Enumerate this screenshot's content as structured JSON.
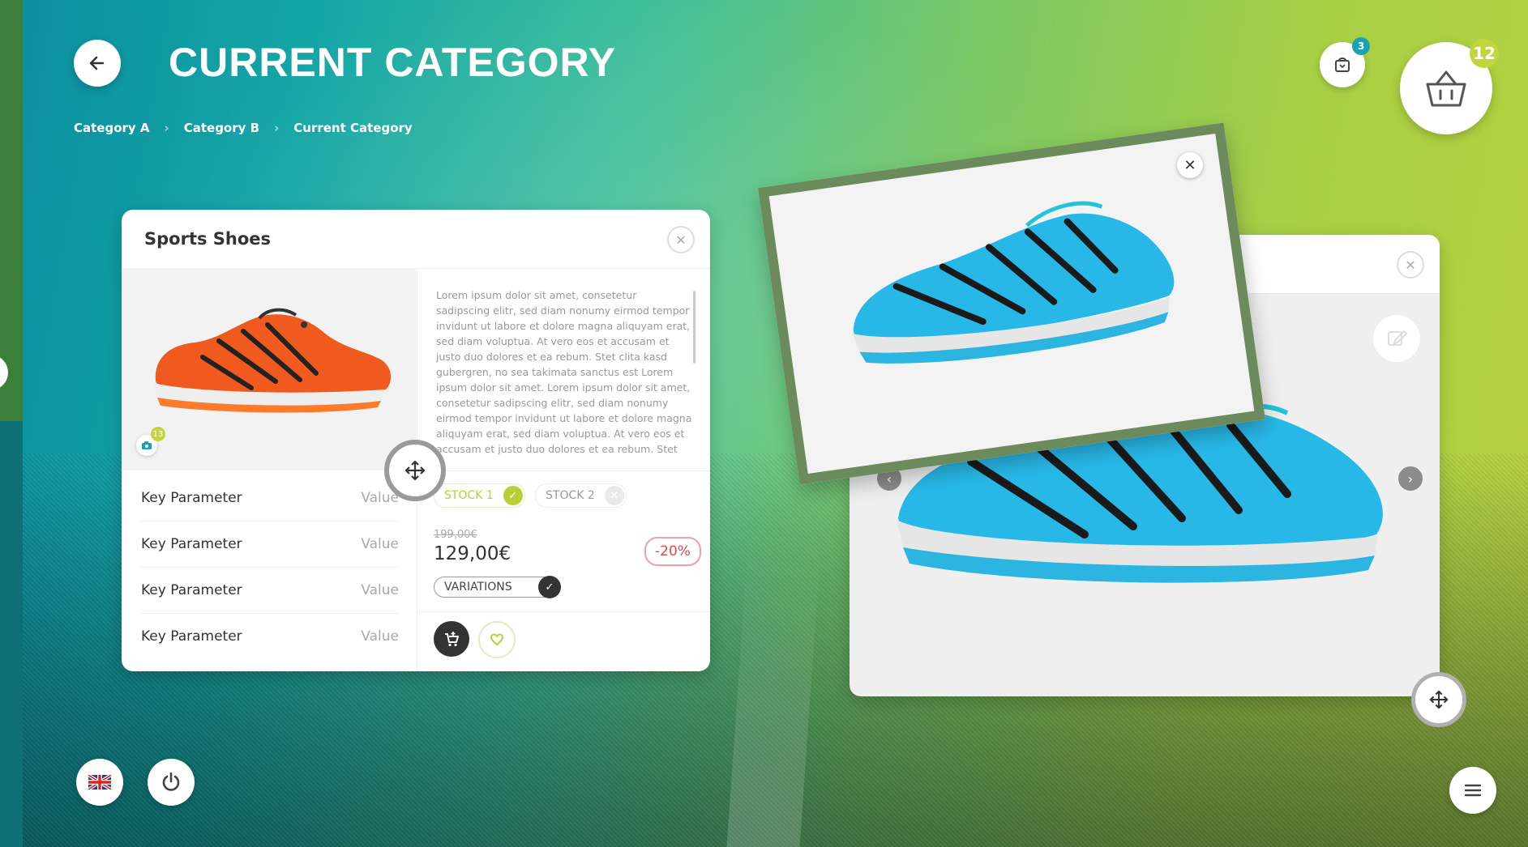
{
  "header": {
    "title": "CURRENT CATEGORY",
    "breadcrumb": [
      "Category A",
      "Category B",
      "Current Category"
    ],
    "small_cart_count": "3",
    "basket_count": "12"
  },
  "product_card": {
    "title": "Sports Shoes",
    "image_count": "13",
    "description": "Lorem ipsum dolor sit amet, consetetur sadipscing elitr, sed diam nonumy eirmod tempor invidunt ut labore et dolore magna aliquyam erat, sed diam voluptua. At vero eos et accusam et justo duo dolores et ea rebum. Stet clita kasd gubergren, no sea takimata sanctus est Lorem ipsum dolor sit amet. Lorem ipsum dolor sit amet, consetetur sadipscing elitr, sed diam nonumy eirmod tempor invidunt ut labore et dolore magna aliquyam erat, sed diam voluptua. At vero eos et accusam et justo duo dolores et ea rebum. Stet clita kasd gubergren",
    "params": [
      {
        "key": "Key Parameter",
        "value": "Value"
      },
      {
        "key": "Key Parameter",
        "value": "Value"
      },
      {
        "key": "Key Parameter",
        "value": "Value"
      },
      {
        "key": "Key Parameter",
        "value": "Value"
      }
    ],
    "stock1": "STOCK 1",
    "stock2": "STOCK 2",
    "old_price": "199,00€",
    "price": "129,00€",
    "discount": "-20%",
    "variations_label": "VARIATIONS"
  },
  "colors": {
    "accent_green": "#c2d63b",
    "accent_teal": "#1aa1b4",
    "discount_red": "#e04848",
    "shoe_orange": "#f05a1e",
    "shoe_blue": "#28b8e8"
  },
  "icons": {
    "back": "arrow-left-icon",
    "small_cart": "cart-icon",
    "basket": "basket-icon",
    "close": "close-icon",
    "move": "move-icon",
    "edit": "edit-icon",
    "camera": "camera-icon",
    "add_to_cart": "add-to-cart-icon",
    "wishlist": "heart-icon",
    "language": "uk-flag-icon",
    "power": "power-icon",
    "menu": "menu-icon"
  }
}
